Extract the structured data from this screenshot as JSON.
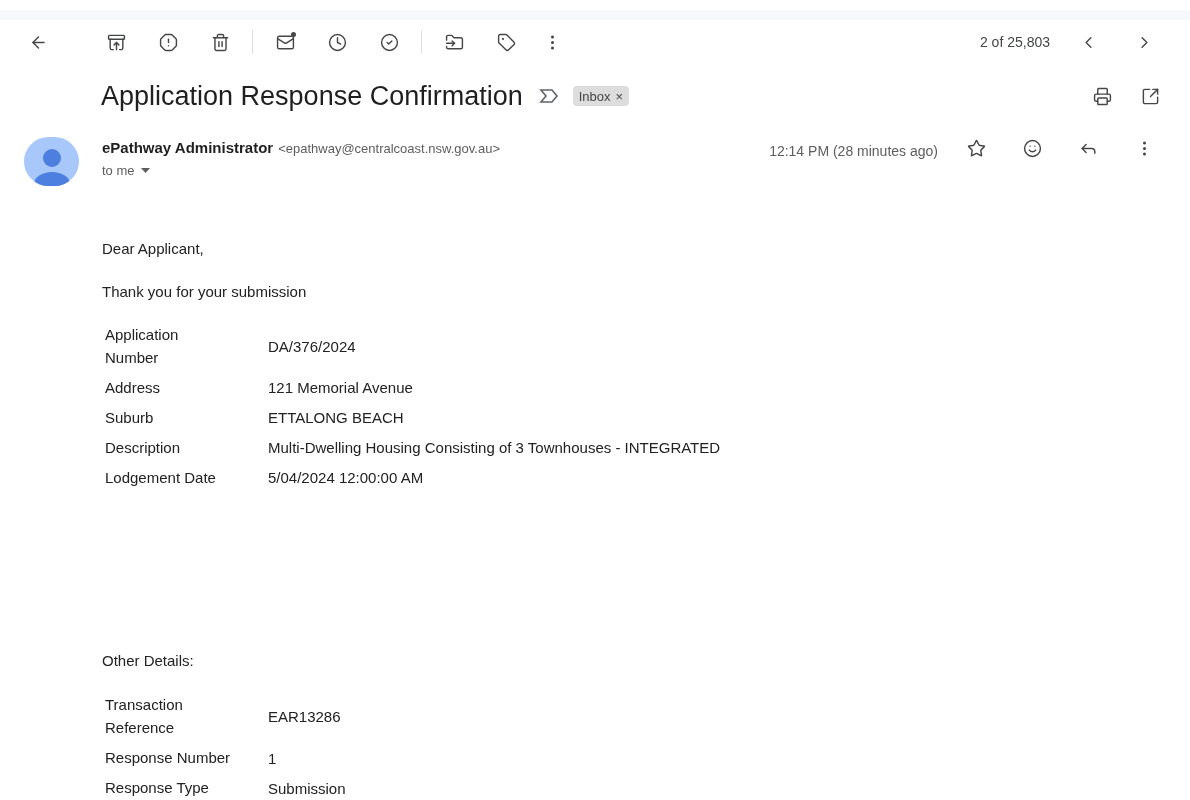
{
  "toolbar": {
    "pager": "2 of 25,803"
  },
  "subject": "Application Response Confirmation",
  "labels": [
    {
      "text": "Inbox",
      "close": "×"
    }
  ],
  "sender": {
    "name": "ePathway Administrator",
    "email": "<epathway@centralcoast.nsw.gov.au>",
    "recipient": "to me",
    "time": "12:14 PM (28 minutes ago)",
    "starred": false
  },
  "body": {
    "greeting": "Dear Applicant,",
    "intro": "Thank you for your submission",
    "details": [
      {
        "label": "Application Number",
        "value": "DA/376/2024"
      },
      {
        "label": "Address",
        "value": "121 Memorial Avenue"
      },
      {
        "label": "Suburb",
        "value": "ETTALONG BEACH"
      },
      {
        "label": "Description",
        "value": "Multi-Dwelling Housing Consisting of 3 Townhouses - INTEGRATED"
      },
      {
        "label": "Lodgement Date",
        "value": "5/04/2024 12:00:00 AM"
      }
    ],
    "other_heading": "Other Details:",
    "other_details": [
      {
        "label": "Transaction Reference",
        "value": "EAR13286"
      },
      {
        "label": "Response Number",
        "value": "1"
      },
      {
        "label": "Response Type",
        "value": "Submission"
      }
    ]
  }
}
